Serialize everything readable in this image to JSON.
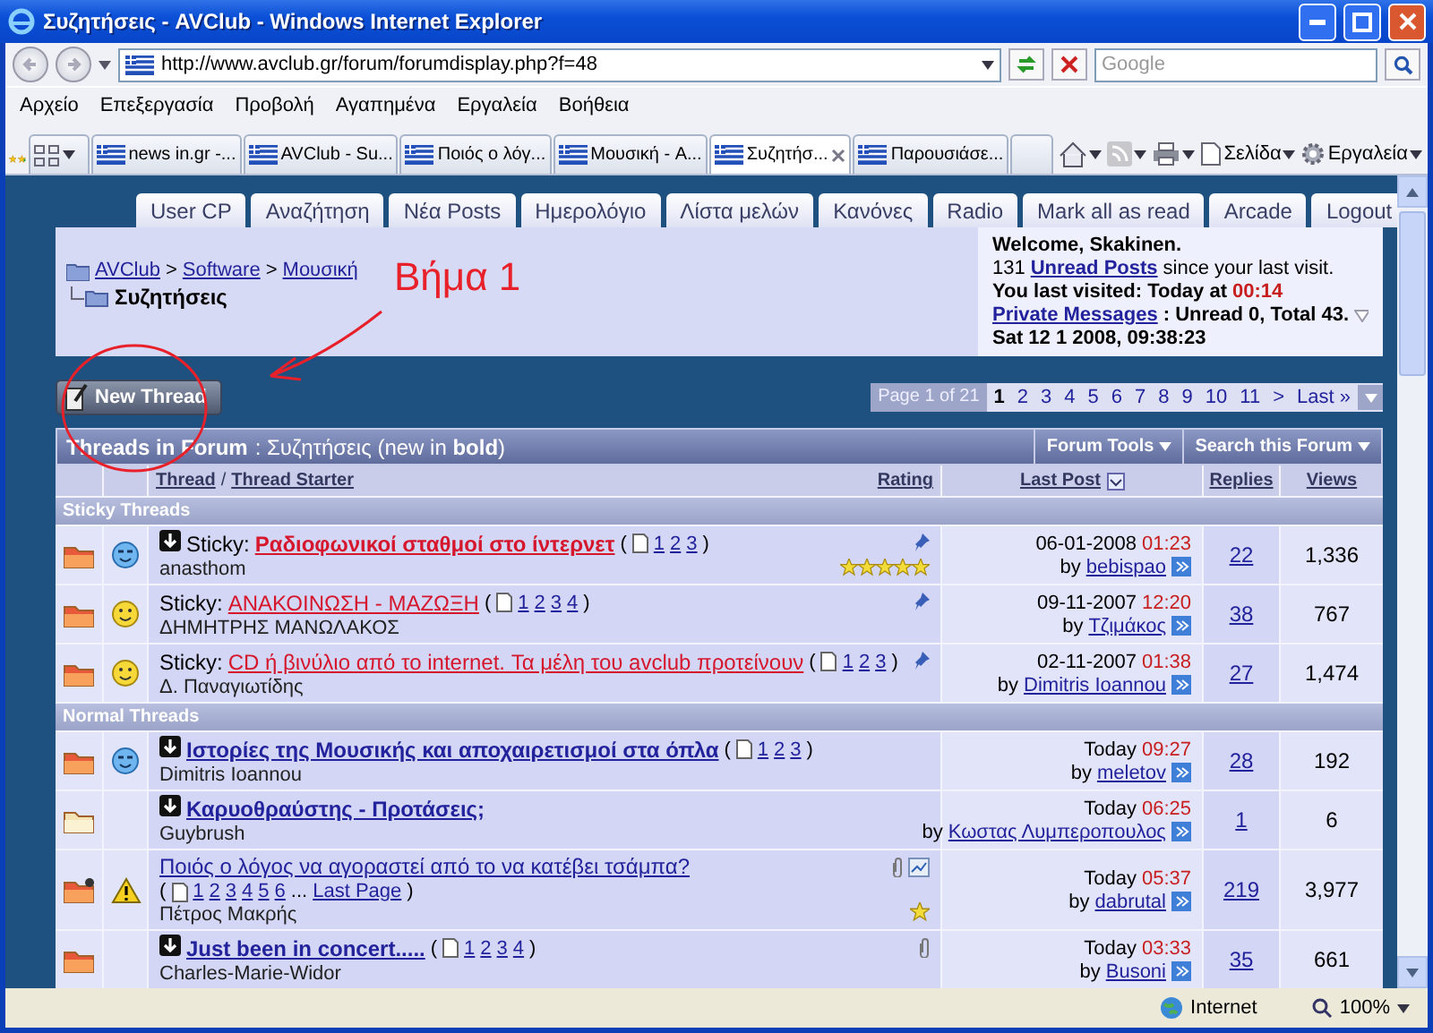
{
  "window": {
    "title": "Συζητήσεις - AVClub - Windows Internet Explorer"
  },
  "address_bar": {
    "url": "http://www.avclub.gr/forum/forumdisplay.php?f=48",
    "search_placeholder": "Google"
  },
  "menu": [
    "Αρχείο",
    "Επεξεργασία",
    "Προβολή",
    "Αγαπημένα",
    "Εργαλεία",
    "Βοήθεια"
  ],
  "browser_tabs": [
    {
      "label": "news in.gr -...",
      "selected": false
    },
    {
      "label": "AVClub - Su...",
      "selected": false
    },
    {
      "label": "Ποιός ο λόγ...",
      "selected": false
    },
    {
      "label": "Μουσική - A...",
      "selected": false
    },
    {
      "label": "Συζητήσ...",
      "selected": true
    },
    {
      "label": "Παρουσιάσε...",
      "selected": false
    }
  ],
  "command_bar": [
    "Σελίδα",
    "Εργαλεία"
  ],
  "nav_tabs": [
    "User CP",
    "Αναζήτηση",
    "Νέα Posts",
    "Ημερολόγιο",
    "Λίστα μελών",
    "Κανόνες",
    "Radio",
    "Mark all as read",
    "Arcade",
    "Logout"
  ],
  "breadcrumb": {
    "items": [
      "AVClub",
      "Software",
      "Μουσική"
    ],
    "separator": ">",
    "current": "Συζητήσεις"
  },
  "welcome": {
    "greeting": "Welcome, Skakinen.",
    "unread_count": "131",
    "unread_link": "Unread Posts",
    "unread_suffix": "since your last visit.",
    "last_visited": "You last visited: Today at",
    "last_visited_time": "00:14",
    "pm_link": "Private Messages",
    "pm_text": ": Unread 0, Total 43.",
    "datetime": "Sat 12 1 2008, 09:38:23"
  },
  "annotation": {
    "text": "Βήμα 1"
  },
  "new_thread_button": "New Thread",
  "pagination": {
    "label": "Page 1 of 21",
    "pages": [
      {
        "label": "1",
        "selected": true
      },
      {
        "label": "2",
        "selected": false
      },
      {
        "label": "3",
        "selected": false
      },
      {
        "label": "4",
        "selected": false
      },
      {
        "label": "5",
        "selected": false
      },
      {
        "label": "6",
        "selected": false
      },
      {
        "label": "7",
        "selected": false
      },
      {
        "label": "8",
        "selected": false
      },
      {
        "label": "9",
        "selected": false
      },
      {
        "label": "10",
        "selected": false
      },
      {
        "label": "11",
        "selected": false
      }
    ],
    "next": ">",
    "last": "Last »"
  },
  "threads_header": {
    "title": "Threads in Forum",
    "subtitle": ": Συζητήσεις (new in **bold**)",
    "tools": [
      "Forum Tools",
      "Search this Forum"
    ]
  },
  "columns": {
    "thread": "Thread",
    "separator": "/",
    "starter": "Thread Starter",
    "rating": "Rating",
    "last_post": "Last Post",
    "replies": "Replies",
    "views": "Views"
  },
  "sections": [
    {
      "title": "Sticky Threads",
      "kind": "sticky",
      "threads": [
        {
          "prefix": "Sticky:",
          "title": "Ραδιοφωνικοί σταθμοί στο ίντερνετ",
          "new": true,
          "hot": true,
          "posted": false,
          "post_icon": {
            "kind": "blue"
          },
          "pages": {
            "open": "(",
            "links": [
              "1",
              "2",
              "3"
            ],
            "close": ")"
          },
          "starter": "anasthom",
          "pinned": true,
          "attachment": false,
          "poll": false,
          "favorite": false,
          "stars": 5,
          "last_post": {
            "date": "06-01-2008",
            "time": "01:23",
            "by": "by",
            "user": "bebispao"
          },
          "replies": "22",
          "views": "1,336"
        },
        {
          "prefix": "Sticky:",
          "title": "ΑΝΑΚΟΙΝΩΣΗ - ΜΑΖΩΞΗ",
          "new": false,
          "hot": true,
          "posted": false,
          "post_icon": {
            "kind": "smile"
          },
          "pages": {
            "open": "(",
            "links": [
              "1",
              "2",
              "3",
              "4"
            ],
            "close": ")"
          },
          "starter": "ΔΗΜΗΤΡΗΣ ΜΑΝΩΛΑΚΟΣ",
          "pinned": true,
          "attachment": false,
          "poll": false,
          "favorite": false,
          "last_post": {
            "date": "09-11-2007",
            "time": "12:20",
            "by": "by",
            "user": "Τζιμάκος"
          },
          "replies": "38",
          "views": "767"
        },
        {
          "prefix": "Sticky:",
          "title": "CD ή βινύλιο από το internet. Τα μέλη του avclub προτείνουν",
          "new": false,
          "hot": true,
          "posted": false,
          "post_icon": {
            "kind": "smile"
          },
          "pages": {
            "open": "(",
            "links": [
              "1",
              "2",
              "3"
            ],
            "close": ")"
          },
          "starter": "Δ. Παναγιωτίδης",
          "pinned": true,
          "attachment": false,
          "poll": false,
          "favorite": false,
          "last_post": {
            "date": "02-11-2007",
            "time": "01:38",
            "by": "by",
            "user": "Dimitris Ioannou"
          },
          "replies": "27",
          "views": "1,474"
        }
      ]
    },
    {
      "title": "Normal Threads",
      "kind": "normal",
      "threads": [
        {
          "title": "Ιστορίες της Μουσικής και αποχαιρετισμοί στα όπλα",
          "new": true,
          "hot": true,
          "posted": false,
          "post_icon": {
            "kind": "blue"
          },
          "pages": {
            "open": "(",
            "links": [
              "1",
              "2",
              "3"
            ],
            "close": ")"
          },
          "starter": "Dimitris Ioannou",
          "pinned": false,
          "attachment": false,
          "poll": false,
          "favorite": false,
          "last_post": {
            "date": "Today",
            "time": "09:27",
            "by": "by",
            "user": "meletov"
          },
          "replies": "28",
          "views": "192"
        },
        {
          "title": "Καρυοθραύστης - Προτάσεις;",
          "new": true,
          "hot": false,
          "posted": false,
          "starter": "Guybrush",
          "pinned": false,
          "attachment": false,
          "poll": false,
          "favorite": false,
          "last_post": {
            "date": "Today",
            "time": "06:25",
            "by": "by",
            "user": "Κωστας Λυμπεροπουλος"
          },
          "replies": "1",
          "views": "6"
        },
        {
          "title": "Ποιός ο λόγος να αγοραστεί από το να κατέβει τσάμπα?",
          "new": false,
          "hot": true,
          "posted": true,
          "post_icon": {
            "kind": "warning"
          },
          "pages": {
            "open": "(",
            "links": [
              "1",
              "2",
              "3",
              "4",
              "5",
              "6"
            ],
            "more": "...",
            "last": "Last Page",
            "close": ")"
          },
          "starter": "Πέτρος Μακρής",
          "pinned": false,
          "attachment": true,
          "poll": true,
          "favorite": true,
          "last_post": {
            "date": "Today",
            "time": "05:37",
            "by": "by",
            "user": "dabrutal"
          },
          "replies": "219",
          "views": "3,977"
        },
        {
          "title": "Just been in concert.....",
          "new": true,
          "hot": true,
          "posted": false,
          "pages": {
            "open": "(",
            "links": [
              "1",
              "2",
              "3",
              "4"
            ],
            "close": ")"
          },
          "starter": "Charles-Marie-Widor",
          "pinned": false,
          "attachment": true,
          "poll": false,
          "favorite": false,
          "last_post": {
            "date": "Today",
            "time": "03:33",
            "by": "by",
            "user": "Busoni"
          },
          "replies": "35",
          "views": "661"
        }
      ]
    }
  ],
  "status_bar": {
    "zone": "Internet",
    "zoom": "100%"
  }
}
